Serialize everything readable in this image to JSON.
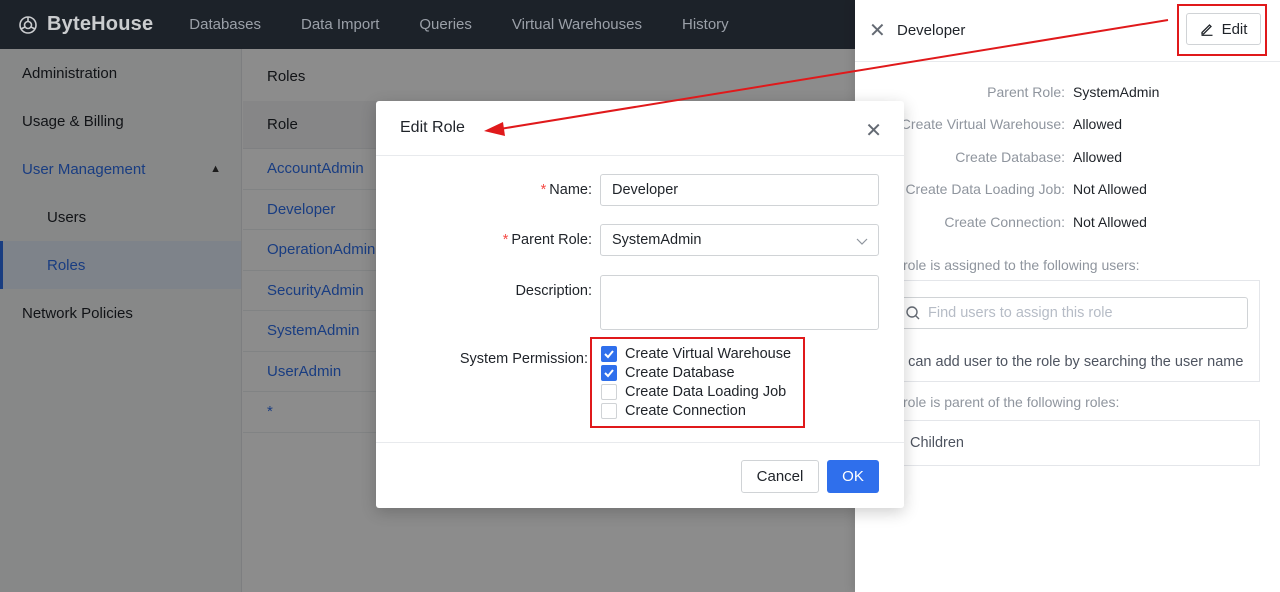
{
  "brand": "ByteHouse",
  "nav": [
    "Databases",
    "Data Import",
    "Queries",
    "Virtual Warehouses",
    "History"
  ],
  "sidebar": {
    "header": "Administration",
    "items": [
      {
        "label": "Usage & Billing"
      },
      {
        "label": "User Management"
      },
      {
        "label": "Users"
      },
      {
        "label": "Roles"
      },
      {
        "label": "Network Policies"
      }
    ]
  },
  "content": {
    "title": "Roles",
    "column": "Role",
    "roles": [
      "AccountAdmin",
      "Developer",
      "OperationAdmin",
      "SecurityAdmin",
      "SystemAdmin",
      "UserAdmin",
      "*"
    ]
  },
  "drawer": {
    "title": "Developer",
    "edit_label": "Edit",
    "details": [
      {
        "key": "Parent Role:",
        "value": "SystemAdmin"
      },
      {
        "key": "Create Virtual Warehouse:",
        "value": "Allowed"
      },
      {
        "key": "Create Database:",
        "value": "Allowed"
      },
      {
        "key": "Create Data Loading Job:",
        "value": "Not Allowed"
      },
      {
        "key": "Create Connection:",
        "value": "Not Allowed"
      }
    ],
    "assigned_label": "role is assigned to the following users:",
    "search_placeholder": "Find users to assign this role",
    "assign_hint": "u can add user to the role by searching the user name",
    "parent_label": "role is parent of the following roles:",
    "children_text": "Children"
  },
  "modal": {
    "title": "Edit Role",
    "name_label": "Name",
    "name_value": "Developer",
    "parent_label": "Parent Role",
    "parent_value": "SystemAdmin",
    "description_label": "Description",
    "description_value": "",
    "permission_label": "System Permission",
    "permissions": [
      {
        "label": "Create Virtual Warehouse",
        "checked": true
      },
      {
        "label": "Create Database",
        "checked": true
      },
      {
        "label": "Create Data Loading Job",
        "checked": false
      },
      {
        "label": "Create Connection",
        "checked": false
      }
    ],
    "cancel_label": "Cancel",
    "ok_label": "OK"
  },
  "colors": {
    "accent": "#2f6fec",
    "topbar": "#222831",
    "annotation": "#e0191b"
  }
}
